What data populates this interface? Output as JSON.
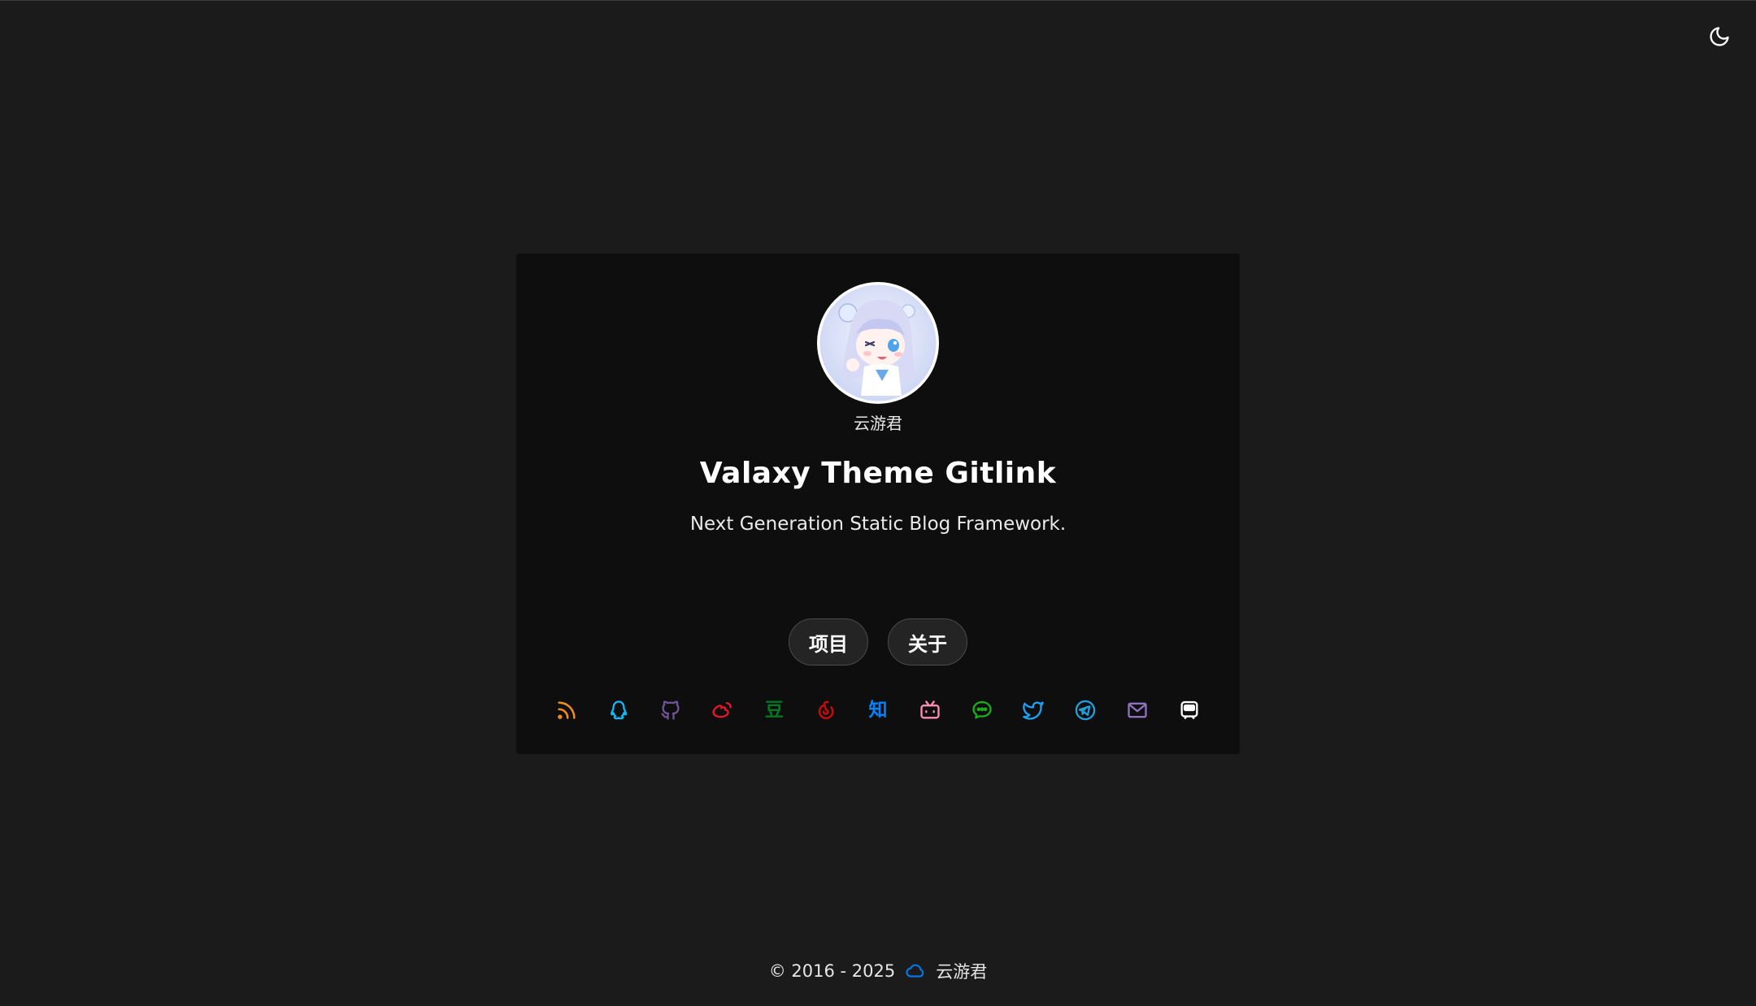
{
  "header": {
    "theme_toggle_icon": "moon-icon"
  },
  "profile": {
    "author": "云游君",
    "title": "Valaxy Theme Gitlink",
    "subtitle": "Next Generation Static Blog Framework."
  },
  "nav_buttons": [
    {
      "label": "项目"
    },
    {
      "label": "关于"
    }
  ],
  "social_links": [
    {
      "icon": "rss-icon",
      "color": "#f08c1a"
    },
    {
      "icon": "qq-icon",
      "color": "#12b7f5"
    },
    {
      "icon": "github-icon",
      "color": "#6e5494"
    },
    {
      "icon": "weibo-icon",
      "color": "#e6162d"
    },
    {
      "icon": "douban-icon",
      "color": "#007722",
      "text": "豆"
    },
    {
      "icon": "netease-music-icon",
      "color": "#c20c0c"
    },
    {
      "icon": "zhihu-icon",
      "color": "#0084ff",
      "text": "知"
    },
    {
      "icon": "bilibili-icon",
      "color": "#ff8eb3"
    },
    {
      "icon": "wechat-icon",
      "color": "#1aad19"
    },
    {
      "icon": "twitter-icon",
      "color": "#1da1f2"
    },
    {
      "icon": "telegram-icon",
      "color": "#229ed9"
    },
    {
      "icon": "email-icon",
      "color": "#8e71c1"
    },
    {
      "icon": "travelling-icon",
      "color": "#ffffff"
    }
  ],
  "footer": {
    "copyright": "© 2016 - 2025",
    "cloud_icon": "cloud-icon",
    "cloud_color": "#0078e7",
    "author": "云游君"
  }
}
